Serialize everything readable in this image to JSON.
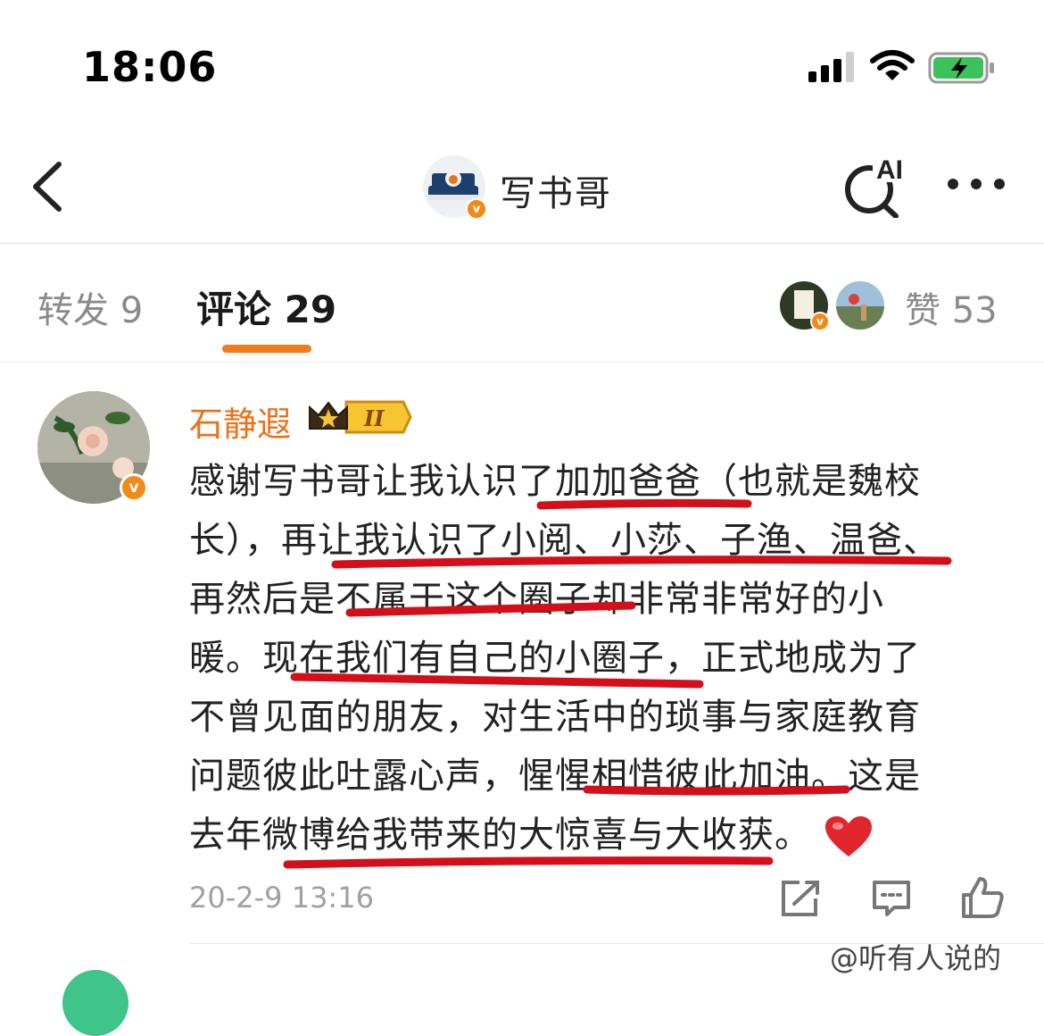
{
  "status_bar": {
    "time": "18:06"
  },
  "nav": {
    "title": "写书哥",
    "ai_label": "AI"
  },
  "tabs": {
    "repost": "转发 9",
    "comments": "评论 29",
    "likes": "赞 53"
  },
  "comment": {
    "username": "石静遐",
    "level": "II",
    "lines": [
      "感谢写书哥让我认识了加加爸爸（也就是魏校",
      "长），再让我认识了小阅、小莎、子渔、温爸、",
      "再然后是不属于这个圈子却非常非常好的小",
      "暖。现在我们有自己的小圈子，正式地成为了",
      "不曾见面的朋友，对生活中的琐事与家庭教育",
      "问题彼此吐露心声，惺惺相惜彼此加油。这是",
      "去年微博给我带来的大惊喜与大收获。"
    ],
    "timestamp": "20-2-9 13:16"
  },
  "watermark": "@听有人说的",
  "colors": {
    "accent_orange": "#f27c1c",
    "username_orange": "#e8731a",
    "annotation_red": "#d40f1a",
    "verified_badge": "#f28a17"
  },
  "icons": [
    "back-icon",
    "ai-search-icon",
    "more-icon",
    "share-icon",
    "reply-icon",
    "like-icon",
    "heart-emoji-icon",
    "crown-badge-icon"
  ]
}
